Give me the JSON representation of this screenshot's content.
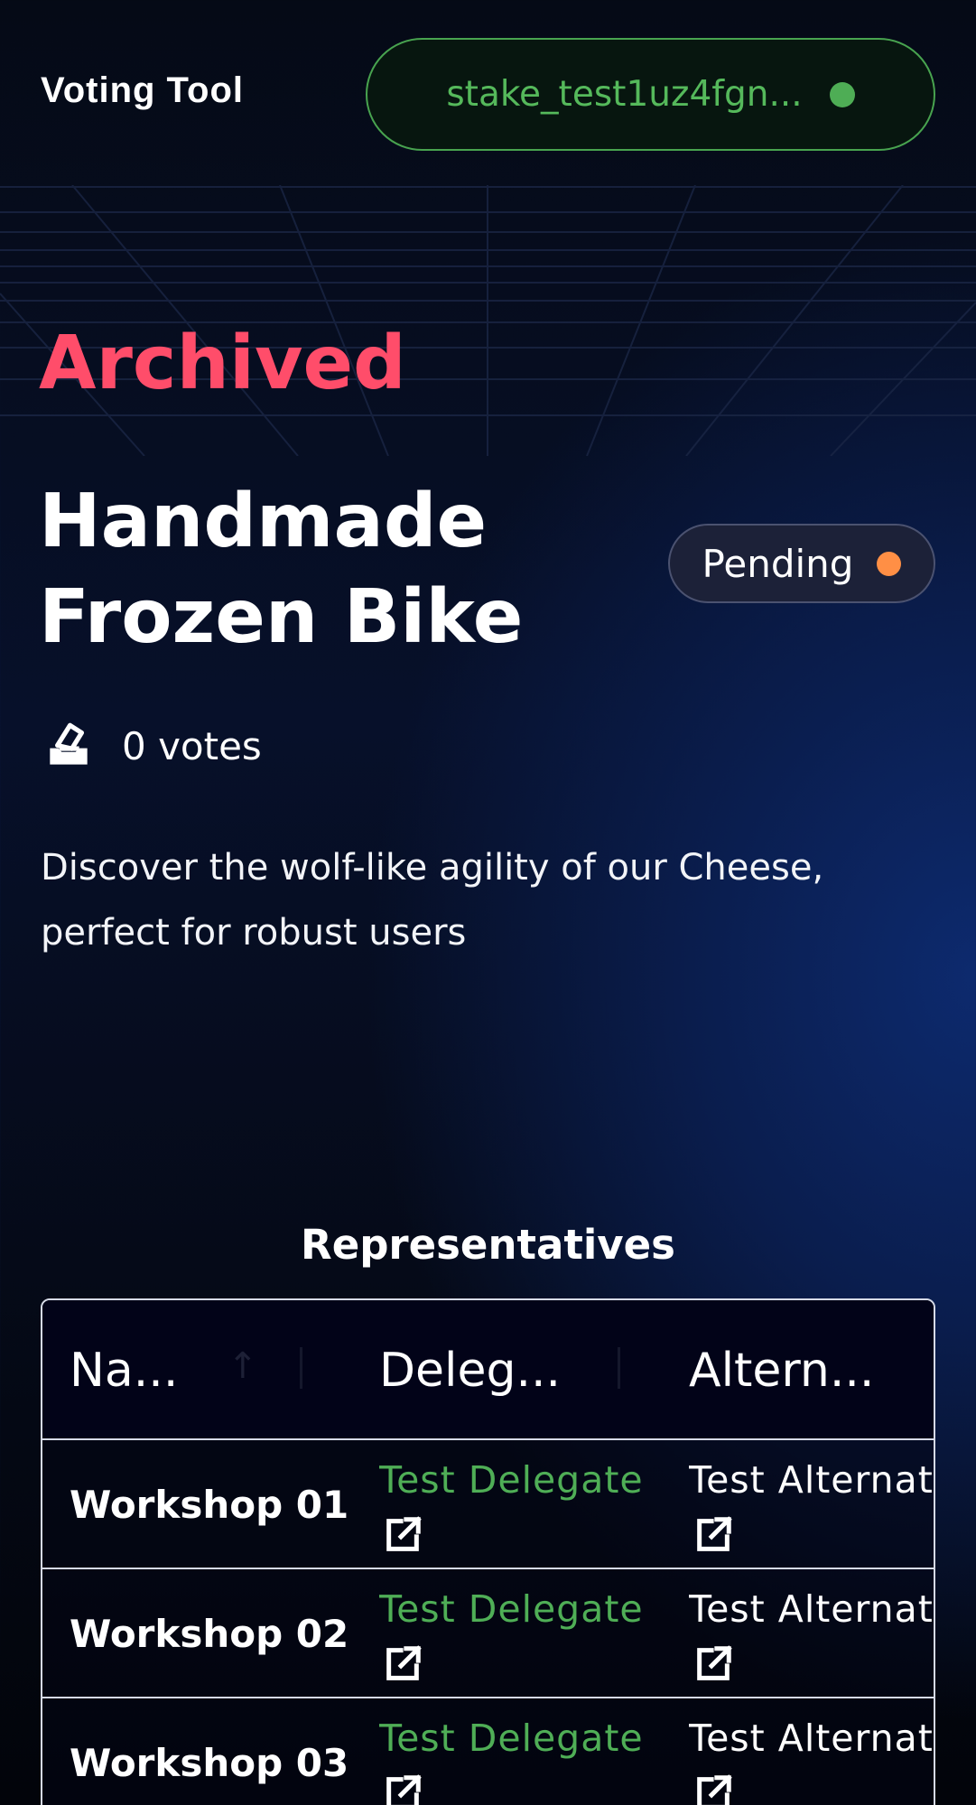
{
  "header": {
    "app_title": "Voting Tool",
    "wallet": {
      "address": "stake_test1uz4fgn...",
      "status_color": "#4ead55"
    }
  },
  "proposal": {
    "state_label": "Archived",
    "title": "Handmade Frozen Bike",
    "status": {
      "label": "Pending",
      "dot_color": "#ff8f45"
    },
    "votes": {
      "text": "0 votes",
      "icon": "ballot-box-icon"
    },
    "description": "Discover the wolf-like agility of our Cheese, perfect for robust users"
  },
  "representatives": {
    "title": "Representatives",
    "columns": [
      "Na...",
      "Deleg...",
      "Altern..."
    ],
    "rows": [
      {
        "name": "Workshop 01",
        "delegate": "Test Delegate (",
        "alternate": "Test Alternat"
      },
      {
        "name": "Workshop 02",
        "delegate": "Test Delegate (",
        "alternate": "Test Alternat"
      },
      {
        "name": "Workshop 03",
        "delegate": "Test Delegate (",
        "alternate": "Test Alternat"
      }
    ],
    "link_icon": "external-link-icon"
  },
  "colors": {
    "accent_green": "#4fae56",
    "archived_red": "#ff4d6a",
    "pending_orange": "#ff8f45"
  }
}
